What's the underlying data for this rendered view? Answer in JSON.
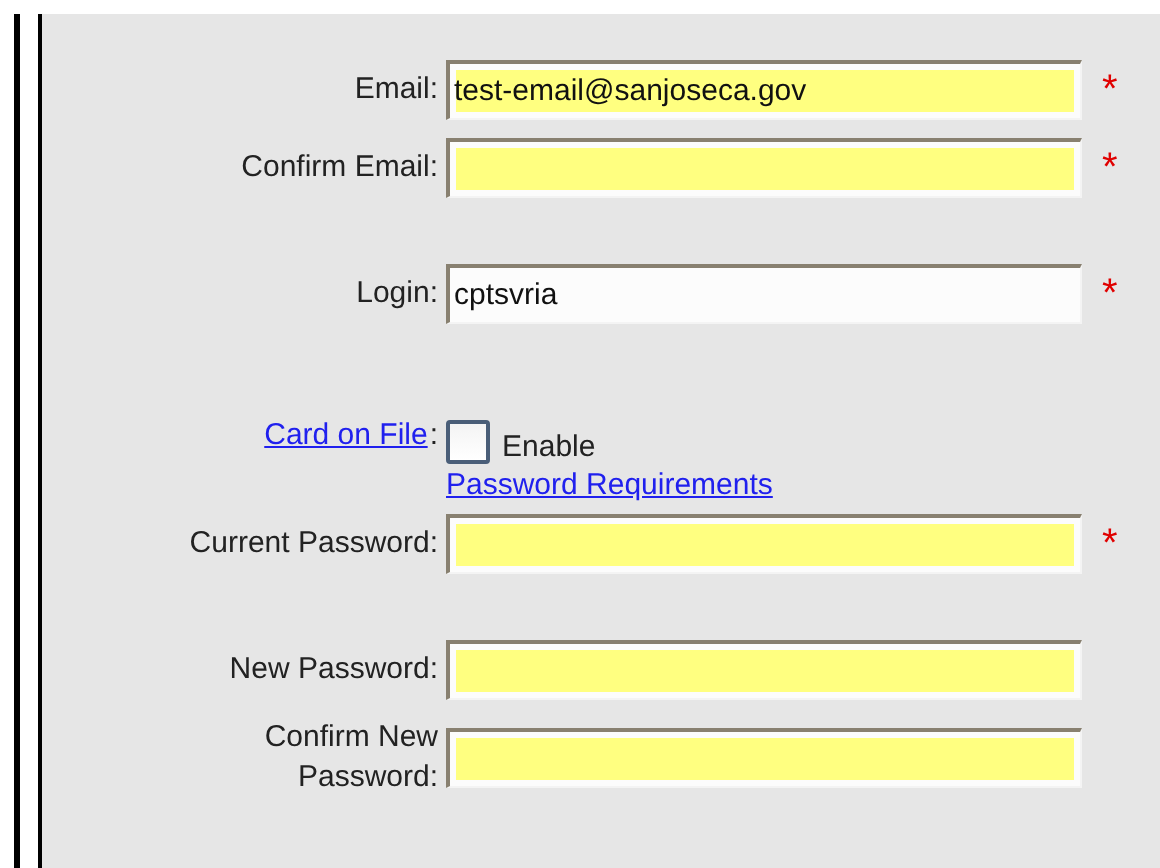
{
  "rows": [
    {
      "kind": "field",
      "label": "Email:",
      "value": "test-email@sanjoseca.gov",
      "highlighted": true,
      "required_mark": "*"
    },
    {
      "kind": "field",
      "label": "Confirm Email:",
      "highlighted": true,
      "required_mark": "*"
    },
    {
      "kind": "gap"
    },
    {
      "kind": "field",
      "label": "Login:",
      "value": "cptsvria",
      "highlighted": false,
      "required_mark": "*"
    },
    {
      "kind": "gap"
    },
    {
      "kind": "checkbox",
      "label": "Card on File",
      "label_suffix": ":",
      "option": "Enable",
      "checked": false
    },
    {
      "kind": "link",
      "text": "Password Requirements"
    },
    {
      "kind": "field",
      "label": "Current Password:",
      "highlighted": true,
      "required_mark": "*"
    },
    {
      "kind": "gap"
    },
    {
      "kind": "field",
      "label": "New Password:",
      "highlighted": true
    },
    {
      "kind": "field",
      "label": "Confirm New Password:",
      "highlighted": true
    }
  ]
}
